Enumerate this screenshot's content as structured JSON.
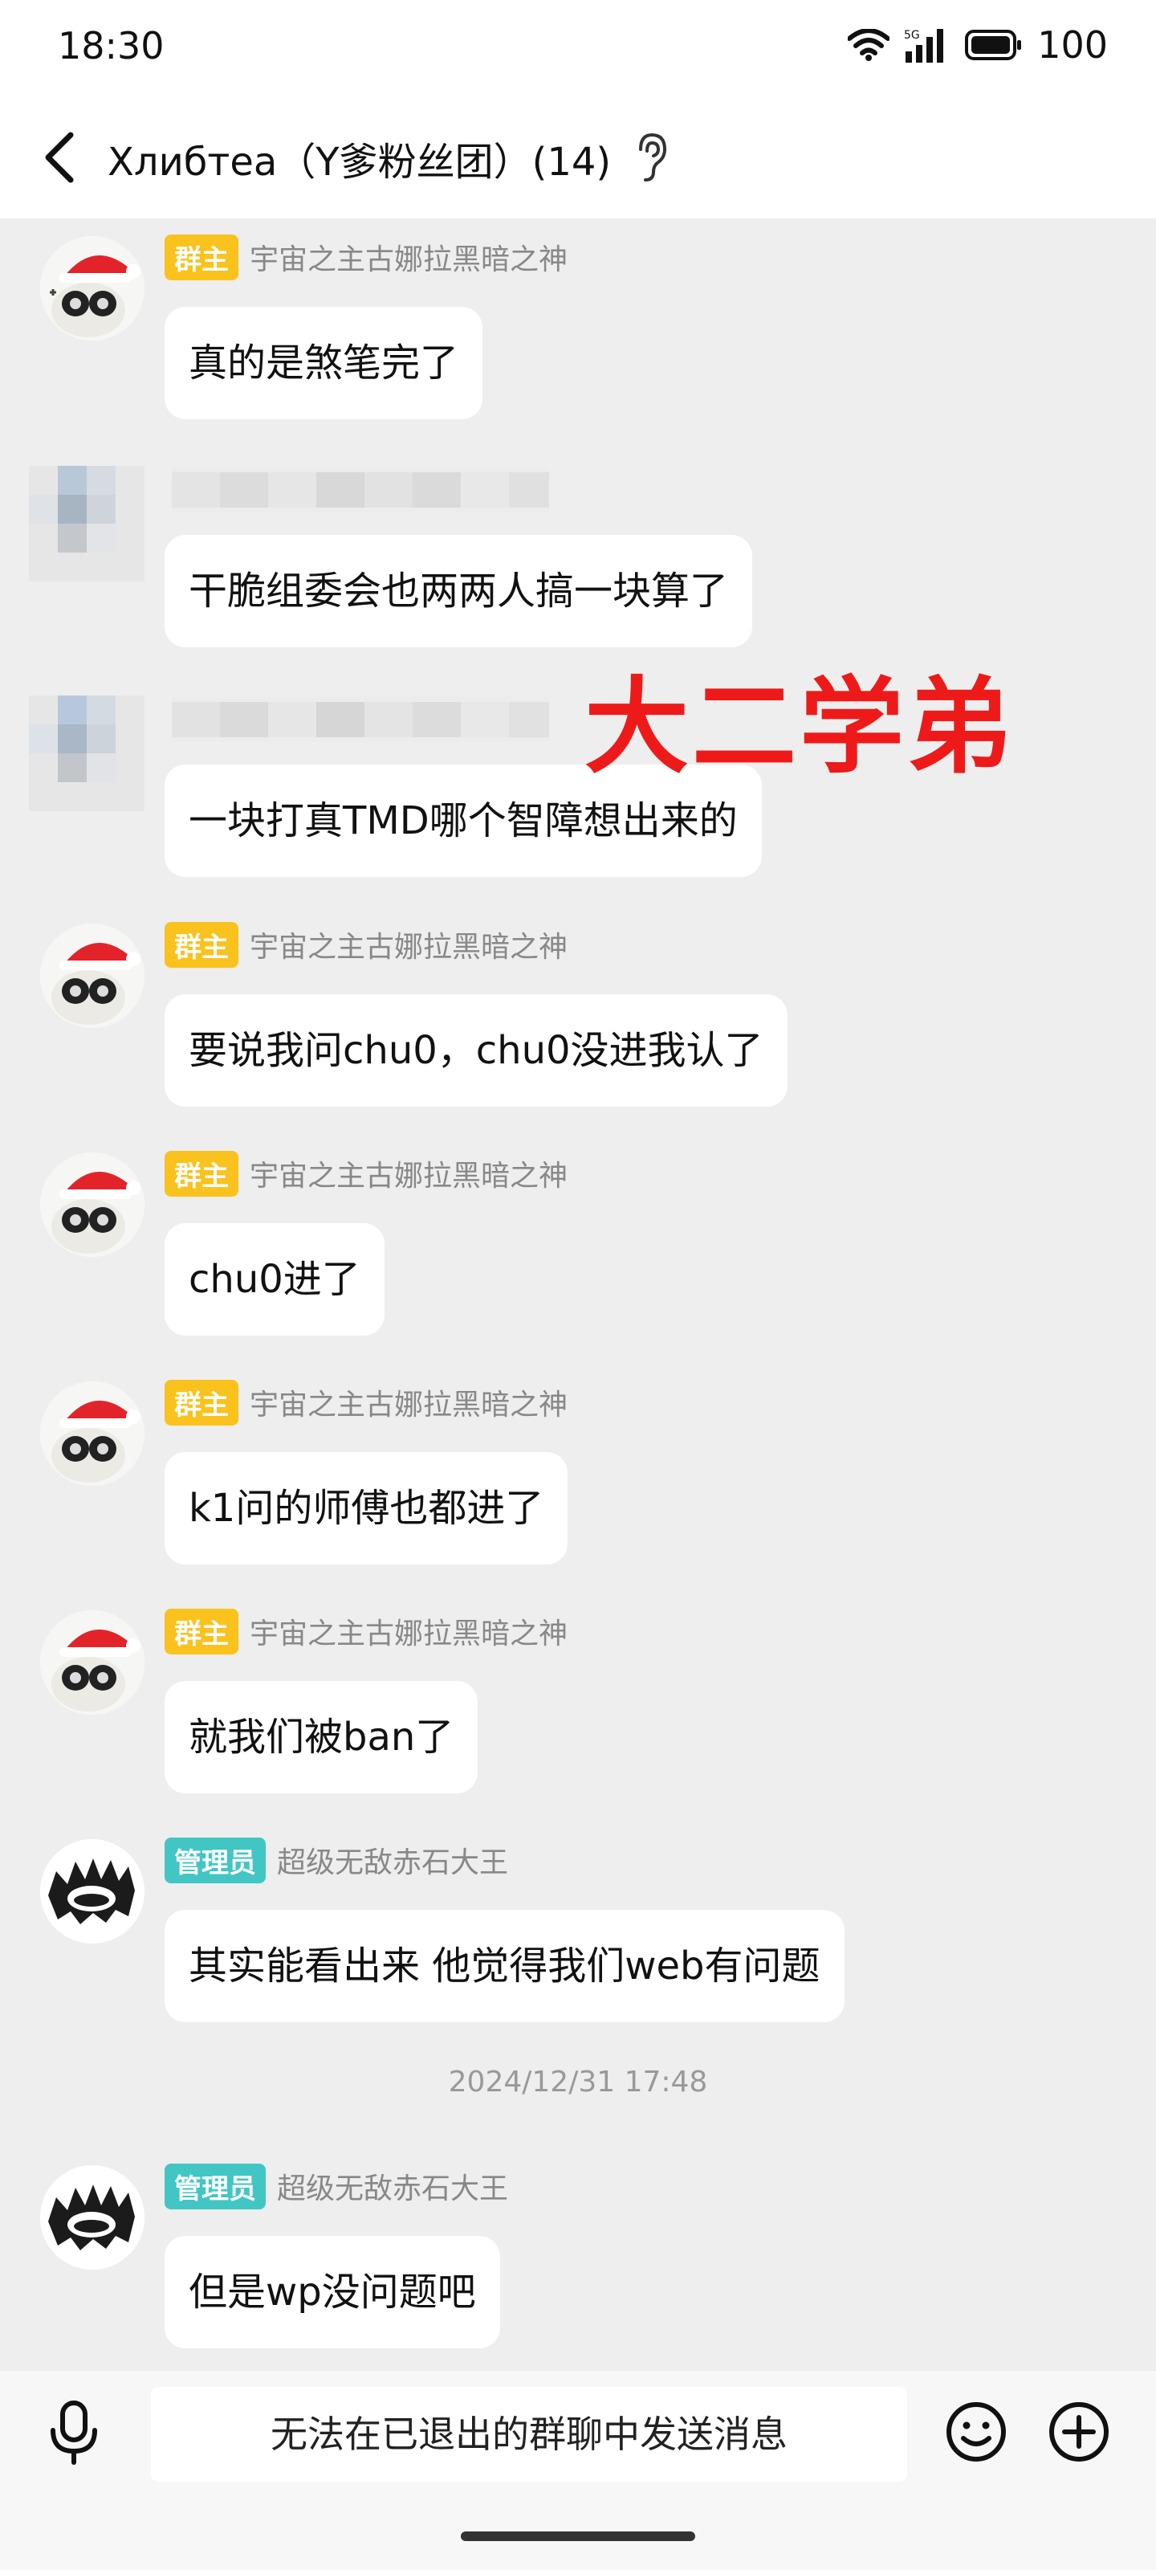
{
  "status_bar": {
    "time": "18:30",
    "battery": "100",
    "network": "5G"
  },
  "header": {
    "title": "Хлибтеа（Y爹粉丝团）(14)"
  },
  "overlay": {
    "text": "大二学弟"
  },
  "messages": [
    {
      "role": "群主",
      "sender": "宇宙之主古娜拉黑暗之神",
      "text": "真的是煞笔完了",
      "avatar": "santa-hat-avatar"
    },
    {
      "role": "",
      "sender": "",
      "text": "干脆组委会也两两人搞一块算了",
      "avatar": "blurred-avatar"
    },
    {
      "role": "",
      "sender": "",
      "text": "一块打真TMD哪个智障想出来的",
      "avatar": "blurred-avatar"
    },
    {
      "role": "群主",
      "sender": "宇宙之主古娜拉黑暗之神",
      "text": "要说我问chu0，chu0没进我认了",
      "avatar": "santa-hat-avatar"
    },
    {
      "role": "群主",
      "sender": "宇宙之主古娜拉黑暗之神",
      "text": "chu0进了",
      "avatar": "santa-hat-avatar"
    },
    {
      "role": "群主",
      "sender": "宇宙之主古娜拉黑暗之神",
      "text": "k1问的师傅也都进了",
      "avatar": "santa-hat-avatar"
    },
    {
      "role": "群主",
      "sender": "宇宙之主古娜拉黑暗之神",
      "text": "就我们被ban了",
      "avatar": "santa-hat-avatar"
    },
    {
      "role": "管理员",
      "sender": "超级无敌赤石大王",
      "text": "其实能看出来 他觉得我们web有问题",
      "avatar": "furry-avatar"
    },
    {
      "role": "管理员",
      "sender": "超级无敌赤石大王",
      "text": "但是wp没问题吧",
      "avatar": "furry-avatar"
    }
  ],
  "timestamp": "2024/12/31 17:48",
  "input": {
    "disabled_text": "无法在已退出的群聊中发送消息"
  },
  "colors": {
    "owner_badge": "#f9c21d",
    "admin_badge": "#41c6c4",
    "overlay": "#ee1a1a",
    "background": "#eeeeee"
  }
}
